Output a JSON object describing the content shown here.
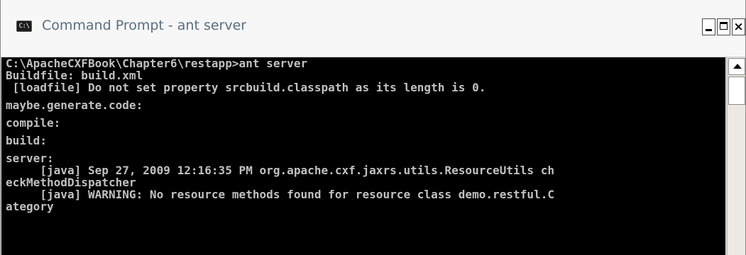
{
  "window": {
    "title": "Command Prompt - ant server",
    "icon": "cmd-icon",
    "icon_text": "C:\\",
    "buttons": {
      "minimize": "minimize-icon",
      "maximize": "maximize-icon",
      "close": "×"
    }
  },
  "console": {
    "colors": {
      "background": "#000000",
      "text": "#c0c0c0",
      "title_text": "#5a6e80"
    },
    "lines": [
      "C:\\ApacheCXFBook\\Chapter6\\restapp>ant server",
      "Buildfile: build.xml",
      " [loadfile] Do not set property srcbuild.classpath as its length is 0.",
      "",
      "maybe.generate.code:",
      "",
      "compile:",
      "",
      "build:",
      "",
      "server:",
      "     [java] Sep 27, 2009 12:16:35 PM org.apache.cxf.jaxrs.utils.ResourceUtils ch",
      "eckMethodDispatcher",
      "     [java] WARNING: No resource methods found for resource class demo.restful.C",
      "ategory"
    ]
  },
  "scrollbar": {
    "up_arrow": "scroll-up-arrow-icon"
  }
}
